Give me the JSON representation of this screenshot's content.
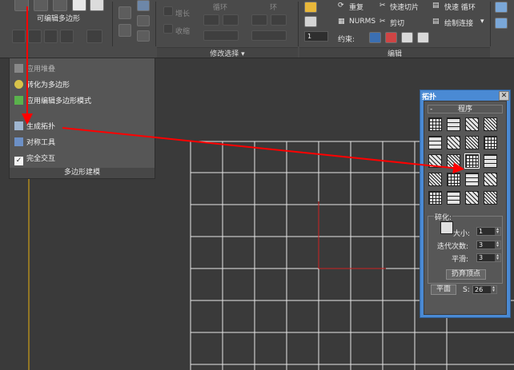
{
  "ribbon": {
    "editable_poly_label": "可编辑多边形",
    "grow_label": "增长",
    "shrink_label": "收缩",
    "loop_label": "循环",
    "ring_label": "环",
    "repeat_label": "重复",
    "quick_slice_label": "快速切片",
    "quick_loop_label": "快速 循环",
    "nurms_label": "NURMS",
    "cut_label": "剪切",
    "paint_connect_label": "绘制连接",
    "constrain_label": "约束:",
    "spinner_value": "1",
    "modify_selection_label": "修改选择 ▾",
    "edit_label": "编辑"
  },
  "dropdown": {
    "items": [
      {
        "label": "应用堆叠",
        "enabled": false
      },
      {
        "label": "转化为多边形",
        "enabled": true
      },
      {
        "label": "应用编辑多边形模式",
        "enabled": true
      },
      {
        "label": "生成拓扑",
        "enabled": true
      },
      {
        "label": "对称工具",
        "enabled": true
      },
      {
        "label": "完全交互",
        "enabled": true
      }
    ],
    "footer": "多边形建模"
  },
  "topology": {
    "title": "拓扑",
    "close": "✕",
    "programs_header": "程序",
    "collapse": "-",
    "refine_label": "碎化:",
    "size_label": "大小:",
    "size_value": "1",
    "iterations_label": "迭代次数:",
    "iterations_value": "3",
    "smooth_label": "平滑:",
    "smooth_value": "3",
    "discard_vertices_label": "扔弃顶点",
    "plane_label": "平面",
    "s_label": "S:",
    "s_value": "26"
  },
  "colors": {
    "annotation_arrow": "#ff0000",
    "panel_title_bar": "#4a8ad4",
    "grid_line": "#e6e6e6"
  }
}
